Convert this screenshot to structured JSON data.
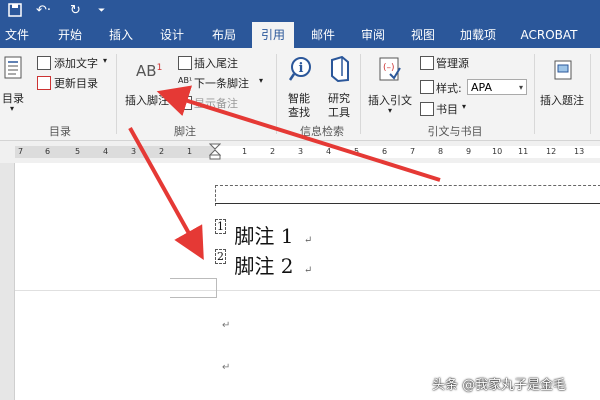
{
  "quick_access": {
    "save_icon": "save-icon",
    "undo": "↶·",
    "redo": "↻",
    "customize": "⏷"
  },
  "tabs": [
    "文件",
    "开始",
    "插入",
    "设计",
    "布局",
    "引用",
    "邮件",
    "审阅",
    "视图",
    "加载项",
    "ACROBAT"
  ],
  "active_tab": "引用",
  "ribbon": {
    "toc": {
      "button": "目录",
      "add_text": "添加文字",
      "update_toc": "更新目录",
      "group": "目录"
    },
    "footnotes": {
      "insert_footnote": "插入脚注",
      "ab_glyph": "AB",
      "superscript": "1",
      "insert_endnote": "插入尾注",
      "next_footnote": "下一条脚注",
      "show_notes": "显示备注",
      "group": "脚注"
    },
    "research": {
      "smart_lookup": [
        "智能",
        "查找"
      ],
      "researcher": [
        "研究",
        "工具"
      ],
      "group": "信息检索"
    },
    "citations": {
      "insert_citation": "插入引文",
      "manage_sources": "管理源",
      "style_label": "样式:",
      "style_value": "APA",
      "bibliography": "书目",
      "group": "引文与书目"
    },
    "captions": {
      "insert_caption": "插入题注"
    }
  },
  "ruler": {
    "left_numbers": [
      "7",
      "6",
      "5",
      "4",
      "3",
      "2",
      "1"
    ],
    "right_numbers": [
      "1",
      "2",
      "3",
      "4",
      "5",
      "6",
      "7",
      "8",
      "9",
      "10",
      "11",
      "12",
      "13"
    ]
  },
  "document": {
    "footnotes": [
      {
        "number": "1",
        "text": "脚注 1"
      },
      {
        "number": "2",
        "text": "脚注 2"
      }
    ],
    "paragraph_mark": "↵"
  },
  "watermark": "头条 @我家丸子是金毛",
  "colors": {
    "ribbon_blue": "#2b579a",
    "arrow_red": "#e53935"
  }
}
